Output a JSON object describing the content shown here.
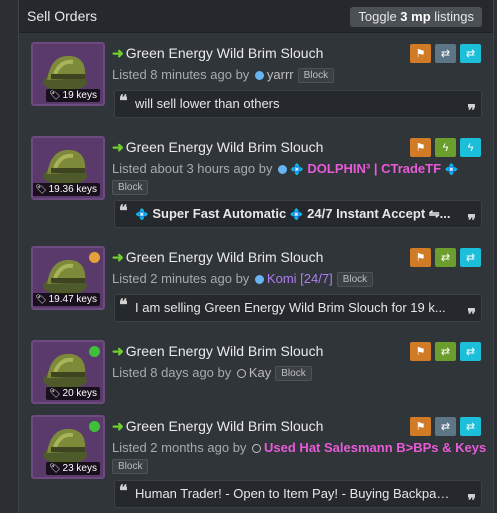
{
  "header": {
    "title": "Sell Orders",
    "toggle_prefix": "Toggle ",
    "toggle_bold": "3 mp",
    "toggle_suffix": " listings"
  },
  "listings": [
    {
      "item_name": "Green Energy Wild Brim Slouch",
      "price": "19 keys",
      "listed_text": "Listed 8 minutes ago by ",
      "user": "yarrr",
      "block": "Block",
      "comment": "will sell lower than others",
      "status_color": ""
    },
    {
      "item_name": "Green Energy Wild Brim Slouch",
      "price": "19.36 keys",
      "listed_text": "Listed about 3 hours ago by ",
      "user": "DOLPHIN³ | CTradeTF",
      "block": "Block",
      "comment": "Super Fast Automatic",
      "comment_2": "24/7 Instant Accept ⇋...",
      "status_color": ""
    },
    {
      "item_name": "Green Energy Wild Brim Slouch",
      "price": "19.47 keys",
      "listed_text": "Listed 2 minutes ago by ",
      "user": "Komi [24/7]",
      "block": "Block",
      "comment": "I am selling Green Energy Wild Brim Slouch for 19 k...",
      "status_color": "#e3a33a"
    },
    {
      "item_name": "Green Energy Wild Brim Slouch",
      "price": "20 keys",
      "listed_text": "Listed 8 days ago by ",
      "user": "Kay",
      "block": "Block",
      "status_color": "#3fbf3a"
    },
    {
      "item_name": "Green Energy Wild Brim Slouch",
      "price": "23 keys",
      "listed_text": "Listed 2 months ago by ",
      "user": "Used Hat Salesmann B>BPs & Keys",
      "block": "Block",
      "comment": "Human Trader! - Open to Item Pay! - Buying Backpac...",
      "status_color": "#3fbf3a"
    }
  ],
  "icon_names": [
    "flag-icon",
    "exchange-icon",
    "lightning-icon",
    "tag-icon",
    "quote-icon",
    "arrow-right-icon"
  ],
  "colors": {
    "flag": "#d17b26",
    "trade": "#5c7687",
    "instant": "#1bbfd9",
    "lightning": "#6b9e2d",
    "quality_border": "#6d4a80"
  }
}
